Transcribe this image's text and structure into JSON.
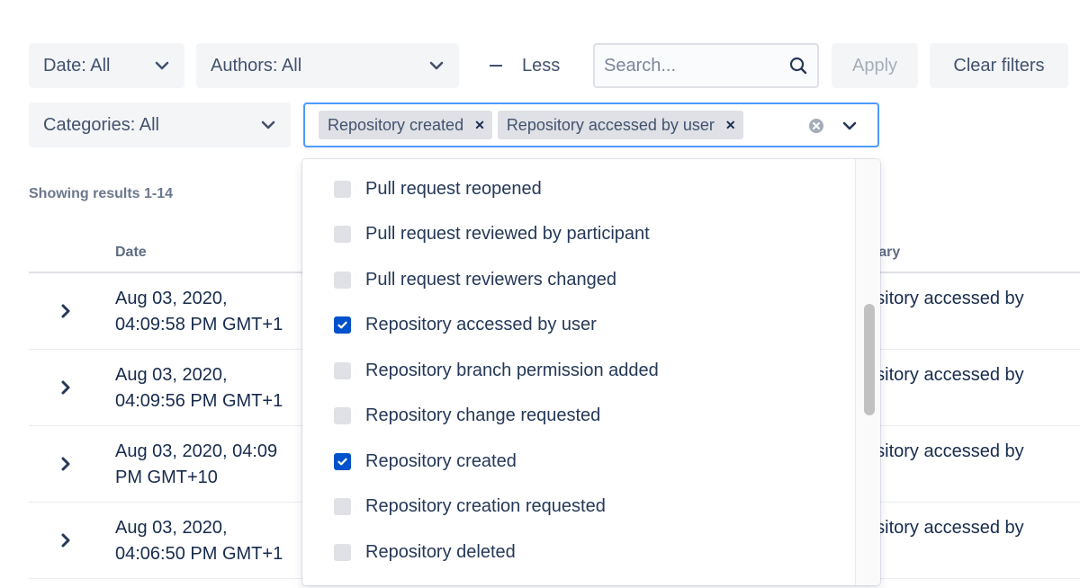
{
  "filters": {
    "date_label": "Date: All",
    "authors_label": "Authors: All",
    "categories_label": "Categories: All",
    "less_label": "Less",
    "search_placeholder": "Search...",
    "search_value": "",
    "apply_label": "Apply",
    "clear_filters_label": "Clear filters"
  },
  "category_multiselect": {
    "selected_tags": [
      {
        "label": "Repository created"
      },
      {
        "label": "Repository accessed by user"
      }
    ]
  },
  "results": {
    "count_text": "Showing results 1-14"
  },
  "table": {
    "columns": {
      "date": "Date",
      "summary": "mary"
    },
    "rows": [
      {
        "date": "Aug 03, 2020,\n04:09:58 PM GMT+1",
        "summary": "ository accessed by\nr"
      },
      {
        "date": "Aug 03, 2020,\n04:09:56 PM GMT+1",
        "summary": "ository accessed by\nr"
      },
      {
        "date": "Aug 03, 2020, 04:09\nPM GMT+10",
        "summary": "ository accessed by\nr"
      },
      {
        "date": "Aug 03, 2020,\n04:06:50 PM GMT+1",
        "summary": "ository accessed by\nr"
      }
    ]
  },
  "dropdown": {
    "options": [
      {
        "label": "Pull request reopened",
        "checked": false
      },
      {
        "label": "Pull request reviewed by participant",
        "checked": false
      },
      {
        "label": "Pull request reviewers changed",
        "checked": false
      },
      {
        "label": "Repository accessed by user",
        "checked": true
      },
      {
        "label": "Repository branch permission added",
        "checked": false
      },
      {
        "label": "Repository change requested",
        "checked": false
      },
      {
        "label": "Repository created",
        "checked": true
      },
      {
        "label": "Repository creation requested",
        "checked": false
      },
      {
        "label": "Repository deleted",
        "checked": false
      }
    ],
    "scroll_position_fraction": 0.46
  },
  "colors": {
    "accent": "#0052cc",
    "focus_border": "#4c9aff",
    "button_bg": "#f4f5f7",
    "text": "#172b4d"
  }
}
